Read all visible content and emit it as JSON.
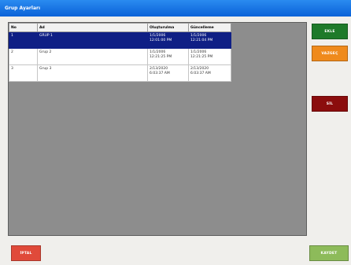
{
  "window": {
    "title": "Grup Ayarları"
  },
  "grid": {
    "columns": [
      "No",
      "Ad",
      "Oluşturulma",
      "Güncelleme"
    ],
    "rows": [
      {
        "no": "1",
        "ad": "GRUP 1",
        "created": "1/1/2006\n12:01:00 PM",
        "updated": "1/1/2006\n12:21:04 PM",
        "selected": true
      },
      {
        "no": "2",
        "ad": "Grup 2",
        "created": "1/1/2006\n12:21:25 PM",
        "updated": "1/1/2006\n12:21:25 PM",
        "selected": false
      },
      {
        "no": "3",
        "ad": "Grup 3",
        "created": "2/13/2020\n6:03:37 AM",
        "updated": "2/13/2020\n6:03:37 AM",
        "selected": false
      }
    ]
  },
  "buttons": {
    "add": "EKLE",
    "cancel": "VAZGEÇ",
    "delete": "SİL",
    "back": "İPTAL",
    "save": "KAYDET"
  },
  "colors": {
    "titlebar": "#0a62d8",
    "selected_row": "#0f1f85",
    "add": "#1e7a2a",
    "cancel": "#ef8a1c",
    "delete": "#8b0d0d",
    "back": "#e04a3a",
    "save": "#8dbb5a"
  }
}
